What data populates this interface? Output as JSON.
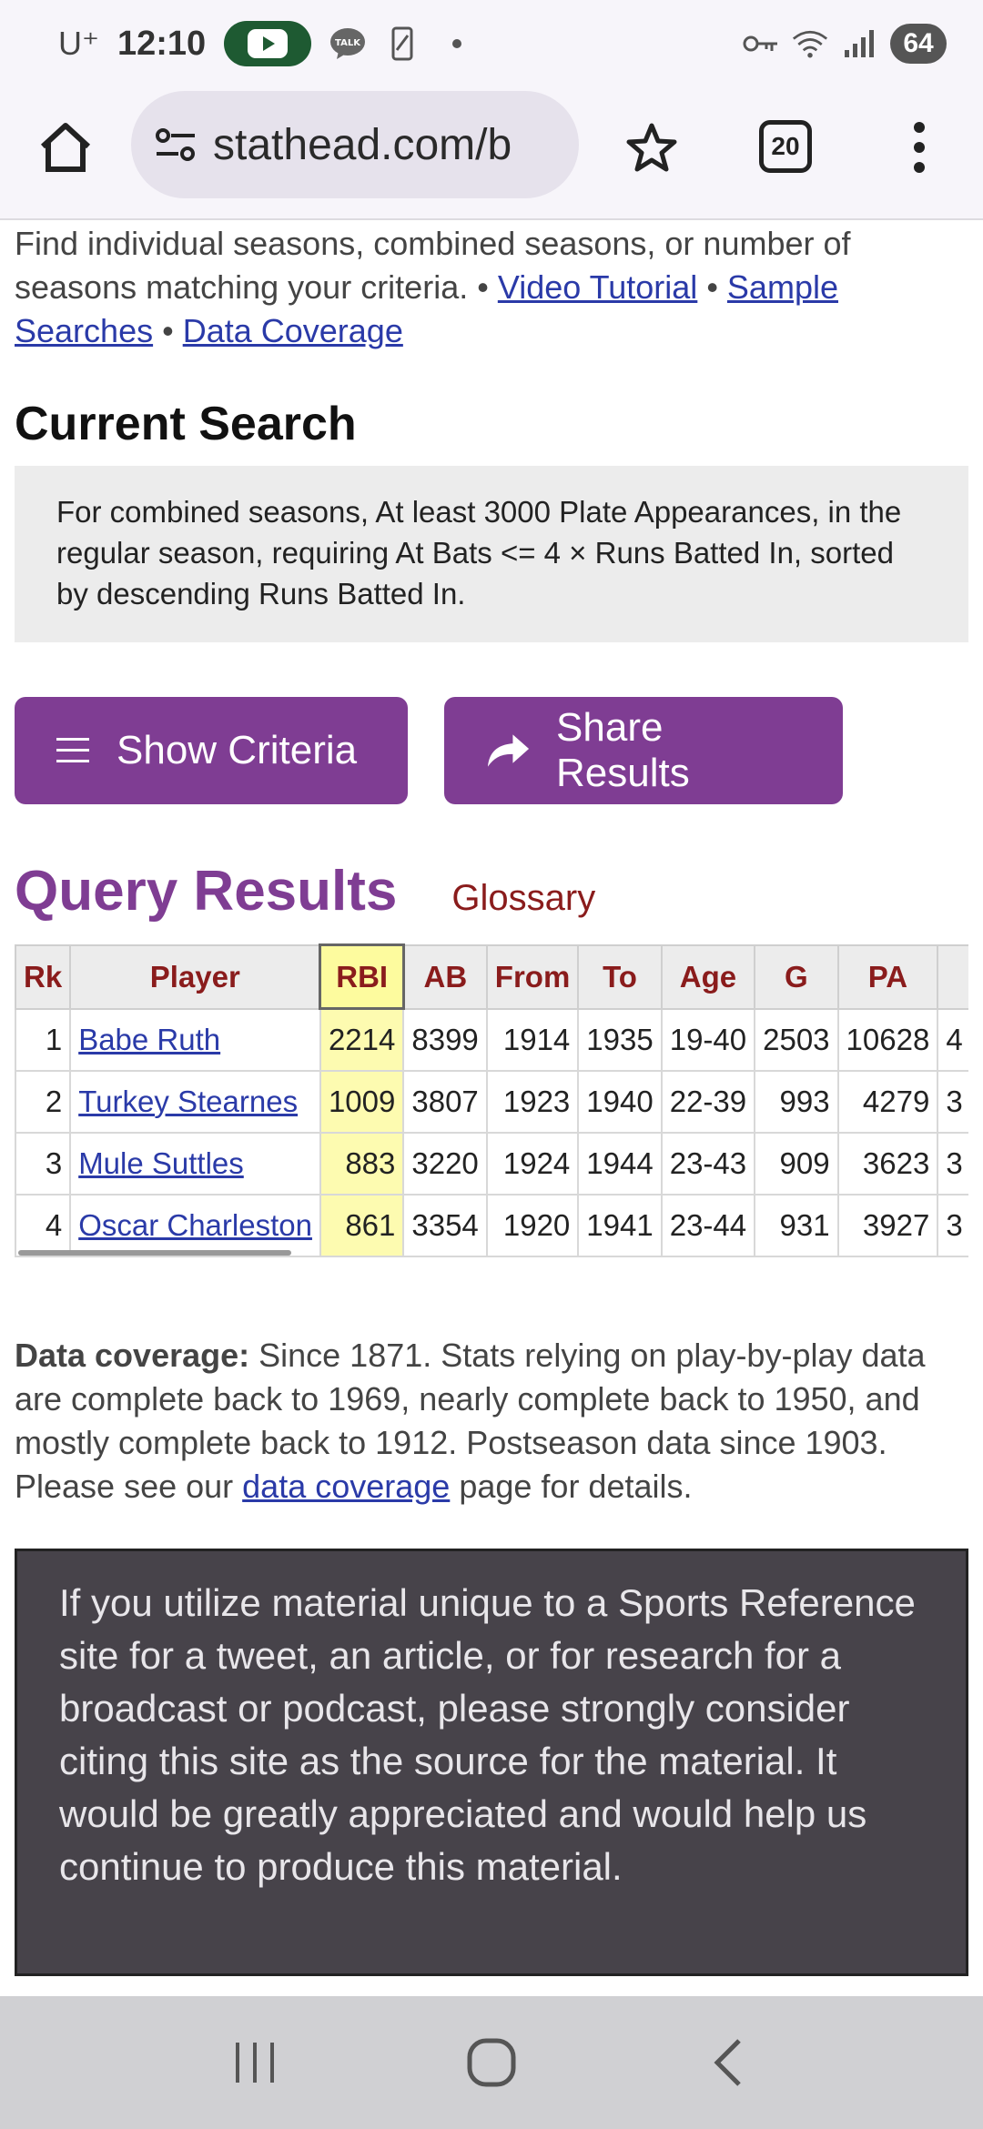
{
  "status_bar": {
    "carrier": "U⁺",
    "time": "12:10",
    "talk_label": "TALK",
    "battery": "64"
  },
  "browser": {
    "url": "stathead.com/b",
    "tab_count": "20"
  },
  "intro": {
    "text": "Find individual seasons, combined seasons, or number of seasons matching your criteria. • ",
    "link_video": "Video Tutorial",
    "sep1": " • ",
    "link_sample": "Sample Searches",
    "sep2": " • ",
    "link_coverage": "Data Coverage"
  },
  "current_search": {
    "heading": "Current Search",
    "description": "For combined seasons, At least 3000 Plate Appearances, in the regular season, requiring At Bats <= 4 × Runs Batted In, sorted by descending Runs Batted In."
  },
  "buttons": {
    "show_criteria": "Show Criteria",
    "share_results": "Share Results"
  },
  "results": {
    "title": "Query Results",
    "glossary": "Glossary",
    "columns": [
      "Rk",
      "Player",
      "RBI",
      "AB",
      "From",
      "To",
      "Age",
      "G",
      "PA",
      ""
    ],
    "rows": [
      {
        "rk": "1",
        "player": "Babe Ruth",
        "rbi": "2214",
        "ab": "8399",
        "from": "1914",
        "to": "1935",
        "age": "19-40",
        "g": "2503",
        "pa": "10628",
        "extra": "4"
      },
      {
        "rk": "2",
        "player": "Turkey Stearnes",
        "rbi": "1009",
        "ab": "3807",
        "from": "1923",
        "to": "1940",
        "age": "22-39",
        "g": "993",
        "pa": "4279",
        "extra": "3"
      },
      {
        "rk": "3",
        "player": "Mule Suttles",
        "rbi": "883",
        "ab": "3220",
        "from": "1924",
        "to": "1944",
        "age": "23-43",
        "g": "909",
        "pa": "3623",
        "extra": "3"
      },
      {
        "rk": "4",
        "player": "Oscar Charleston",
        "rbi": "861",
        "ab": "3354",
        "from": "1920",
        "to": "1941",
        "age": "23-44",
        "g": "931",
        "pa": "3927",
        "extra": "3"
      }
    ]
  },
  "coverage": {
    "label": "Data coverage:",
    "text": " Since 1871. Stats relying on play-by-play data are complete back to 1969, nearly complete back to 1950, and mostly complete back to 1912. Postseason data since 1903. Please see our ",
    "link": "data coverage",
    "tail": " page for details."
  },
  "notice": {
    "text": "If you utilize material unique to a Sports Reference site for a tweet, an article, or for research for a broadcast or podcast, please strongly consider citing this site as the source for the material. It would be greatly appreciated and would help us continue to produce this material."
  },
  "colors": {
    "accent": "#7f3d93",
    "header_text": "#8a1c1c",
    "link": "#2a3aa8",
    "highlight": "#fdfb9e",
    "notice_bg": "#47434a"
  }
}
